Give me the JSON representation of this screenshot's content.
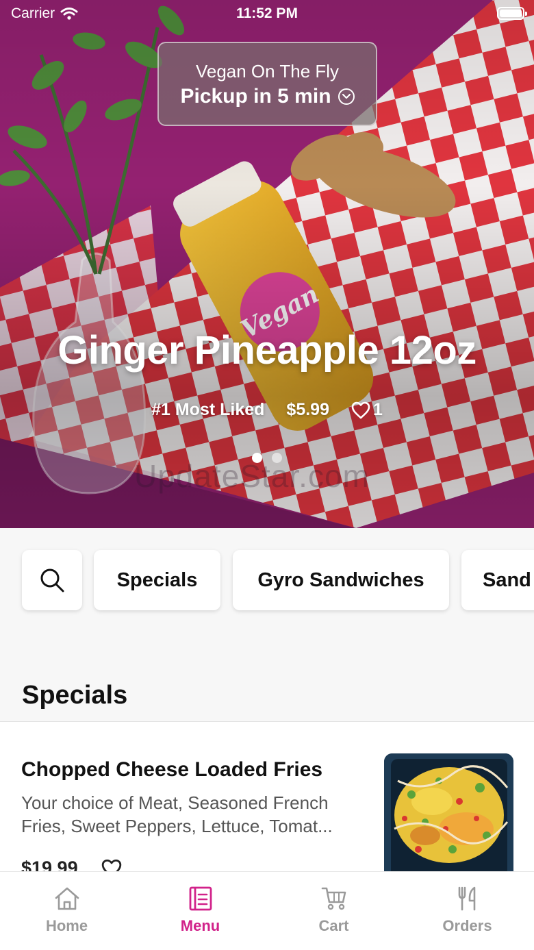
{
  "status_bar": {
    "carrier": "Carrier",
    "time": "11:52 PM"
  },
  "hero": {
    "pickup": {
      "restaurant": "Vegan On The Fly",
      "eta": "Pickup in 5 min"
    },
    "featured": {
      "title": "Ginger Pineapple 12oz",
      "badge": "#1 Most Liked",
      "price": "$5.99",
      "likes": "1"
    },
    "slides": 2,
    "active_slide": 1,
    "watermark": "UpdateStar.com"
  },
  "categories": {
    "search_icon": "search-icon",
    "chips": [
      {
        "label": "Specials"
      },
      {
        "label": "Gyro Sandwiches"
      },
      {
        "label": "Sand"
      }
    ]
  },
  "section": {
    "title": "Specials",
    "items": [
      {
        "name": "Chopped Cheese Loaded Fries",
        "description": "Your choice of Meat, Seasoned French Fries, Sweet Peppers, Lettuce, Tomat...",
        "price": "$19.99"
      }
    ]
  },
  "tabbar": {
    "tabs": [
      {
        "label": "Home",
        "icon": "home-icon"
      },
      {
        "label": "Menu",
        "icon": "menu-icon"
      },
      {
        "label": "Cart",
        "icon": "cart-icon"
      },
      {
        "label": "Orders",
        "icon": "utensils-icon"
      }
    ],
    "active_tab": "Menu"
  },
  "colors": {
    "accent": "#d1228a",
    "inactive": "#9a9a9a",
    "hero_bg": "#8e1f6e"
  }
}
